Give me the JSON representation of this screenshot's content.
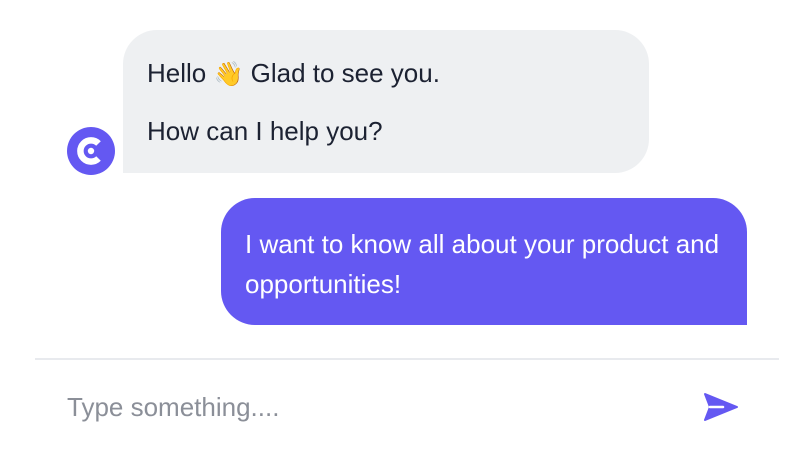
{
  "colors": {
    "accent": "#6458f2",
    "incoming_bubble": "#eef0f2",
    "text": "#1c2232",
    "placeholder": "#8b8f98",
    "divider": "#e8eaee"
  },
  "avatar": {
    "icon": "c-logo-icon"
  },
  "messages": {
    "incoming": {
      "line1_pre": "Hello",
      "emoji": "👋",
      "line1_post": "Glad to see you.",
      "line2": "How can I help you?"
    },
    "outgoing": {
      "text": "I want to know all about your product and opportunities!"
    }
  },
  "composer": {
    "placeholder": "Type something....",
    "value": "",
    "send_icon": "send-icon"
  }
}
